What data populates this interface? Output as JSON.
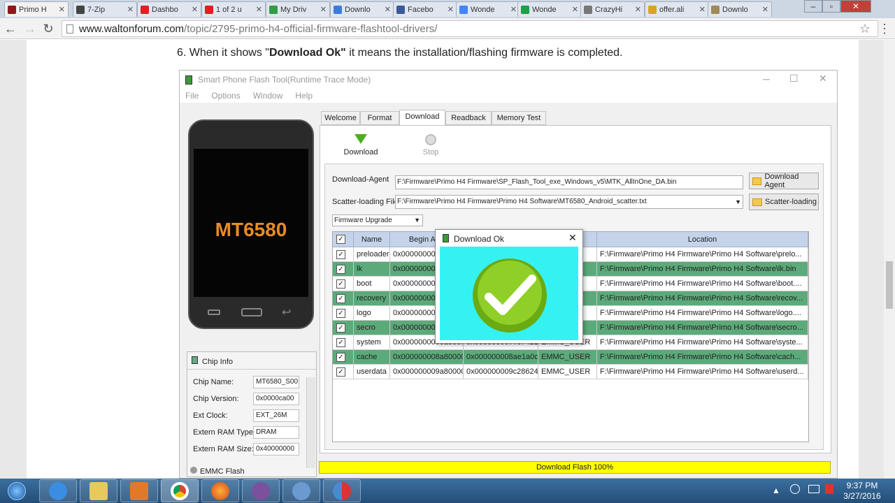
{
  "browser": {
    "tabs": [
      {
        "title": "Primo H",
        "color": "#8c1a1a"
      },
      {
        "title": "7-Zip",
        "color": "#444444"
      },
      {
        "title": "Dashbo",
        "color": "#e02020"
      },
      {
        "title": "1 of 2 u",
        "color": "#e02020"
      },
      {
        "title": "My Driv",
        "color": "#2f9e44"
      },
      {
        "title": "Downlo",
        "color": "#3b7ddd"
      },
      {
        "title": "Facebo",
        "color": "#3b5998"
      },
      {
        "title": "Wonde",
        "color": "#4285f4"
      },
      {
        "title": "Wonde",
        "color": "#1fa045"
      },
      {
        "title": "CrazyHi",
        "color": "#777777"
      },
      {
        "title": "offer.ali",
        "color": "#d9a520"
      },
      {
        "title": "Downlo",
        "color": "#a08a5a"
      }
    ],
    "url_host": "www.waltonforum.com",
    "url_path": "/topic/2795-primo-h4-official-firmware-flashtool-drivers/"
  },
  "article": {
    "step_prefix": "6. When it shows \"",
    "step_bold": "Download Ok\"",
    "step_suffix": " it means the installation/flashing firmware is completed."
  },
  "app": {
    "title": "Smart Phone Flash Tool(Runtime Trace Mode)",
    "menu": [
      "File",
      "Options",
      "Window",
      "Help"
    ],
    "phone_label": "MT6580",
    "tabs": [
      "Welcome",
      "Format",
      "Download",
      "Readback",
      "Memory Test"
    ],
    "toolbar": {
      "download": "Download",
      "stop": "Stop"
    },
    "download_agent_label": "Download-Agent",
    "download_agent_value": "F:\\Firmware\\Primo H4 Firmware\\SP_Flash_Tool_exe_Windows_v5\\MTK_AllInOne_DA.bin",
    "download_agent_button": "Download Agent",
    "scatter_label": "Scatter-loading File",
    "scatter_value": "F:\\Firmware\\Primo H4 Firmware\\Primo H4 Software\\MT6580_Android_scatter.txt",
    "scatter_button": "Scatter-loading",
    "mode": "Firmware Upgrade",
    "table_headers": [
      "Name",
      "Begin Add",
      "",
      "",
      "Location"
    ],
    "rows": [
      {
        "name": "preloader",
        "begin": "0x0000000000",
        "end": "",
        "region": "T_1",
        "loc": "F:\\Firmware\\Primo H4 Firmware\\Primo H4 Software\\prelo..."
      },
      {
        "name": "lk",
        "begin": "0x0000000001",
        "end": "",
        "region": "",
        "loc": "F:\\Firmware\\Primo H4 Firmware\\Primo H4 Software\\lk.bin"
      },
      {
        "name": "boot",
        "begin": "0x0000000001",
        "end": "",
        "region": "",
        "loc": "F:\\Firmware\\Primo H4 Firmware\\Primo H4 Software\\boot...."
      },
      {
        "name": "recovery",
        "begin": "0x0000000002",
        "end": "",
        "region": "",
        "loc": "F:\\Firmware\\Primo H4 Firmware\\Primo H4 Software\\recov..."
      },
      {
        "name": "logo",
        "begin": "0x0000000003",
        "end": "",
        "region": "",
        "loc": "F:\\Firmware\\Primo H4 Firmware\\Primo H4 Software\\logo...."
      },
      {
        "name": "secro",
        "begin": "0x0000000009",
        "end": "",
        "region": "",
        "loc": "F:\\Firmware\\Primo H4 Firmware\\Primo H4 Software\\secro..."
      },
      {
        "name": "system",
        "begin": "0x0000000000a00000",
        "end": "0x00000000??c7421b",
        "region": "EMMC_USER",
        "loc": "F:\\Firmware\\Primo H4 Firmware\\Primo H4 Software\\syste..."
      },
      {
        "name": "cache",
        "begin": "0x000000008a800000",
        "end": "0x000000008ae1a0cf",
        "region": "EMMC_USER",
        "loc": "F:\\Firmware\\Primo H4 Firmware\\Primo H4 Software\\cach..."
      },
      {
        "name": "userdata",
        "begin": "0x000000009a800000",
        "end": "0x000000009c28624f",
        "region": "EMMC_USER",
        "loc": "F:\\Firmware\\Primo H4 Firmware\\Primo H4 Software\\userd..."
      }
    ],
    "chip": {
      "header": "Chip Info",
      "fields": [
        {
          "label": "Chip Name:",
          "value": "MT6580_S00"
        },
        {
          "label": "Chip Version:",
          "value": "0x0000ca00"
        },
        {
          "label": "Ext Clock:",
          "value": "EXT_26M"
        },
        {
          "label": "Extern RAM Type:",
          "value": "DRAM"
        },
        {
          "label": "Extern RAM Size:",
          "value": "0x40000000"
        }
      ],
      "emmc": "EMMC Flash"
    },
    "status": "Download Flash 100%",
    "dialog_title": "Download Ok"
  },
  "taskbar": {
    "time": "9:37 PM",
    "date": "3/27/2016"
  }
}
